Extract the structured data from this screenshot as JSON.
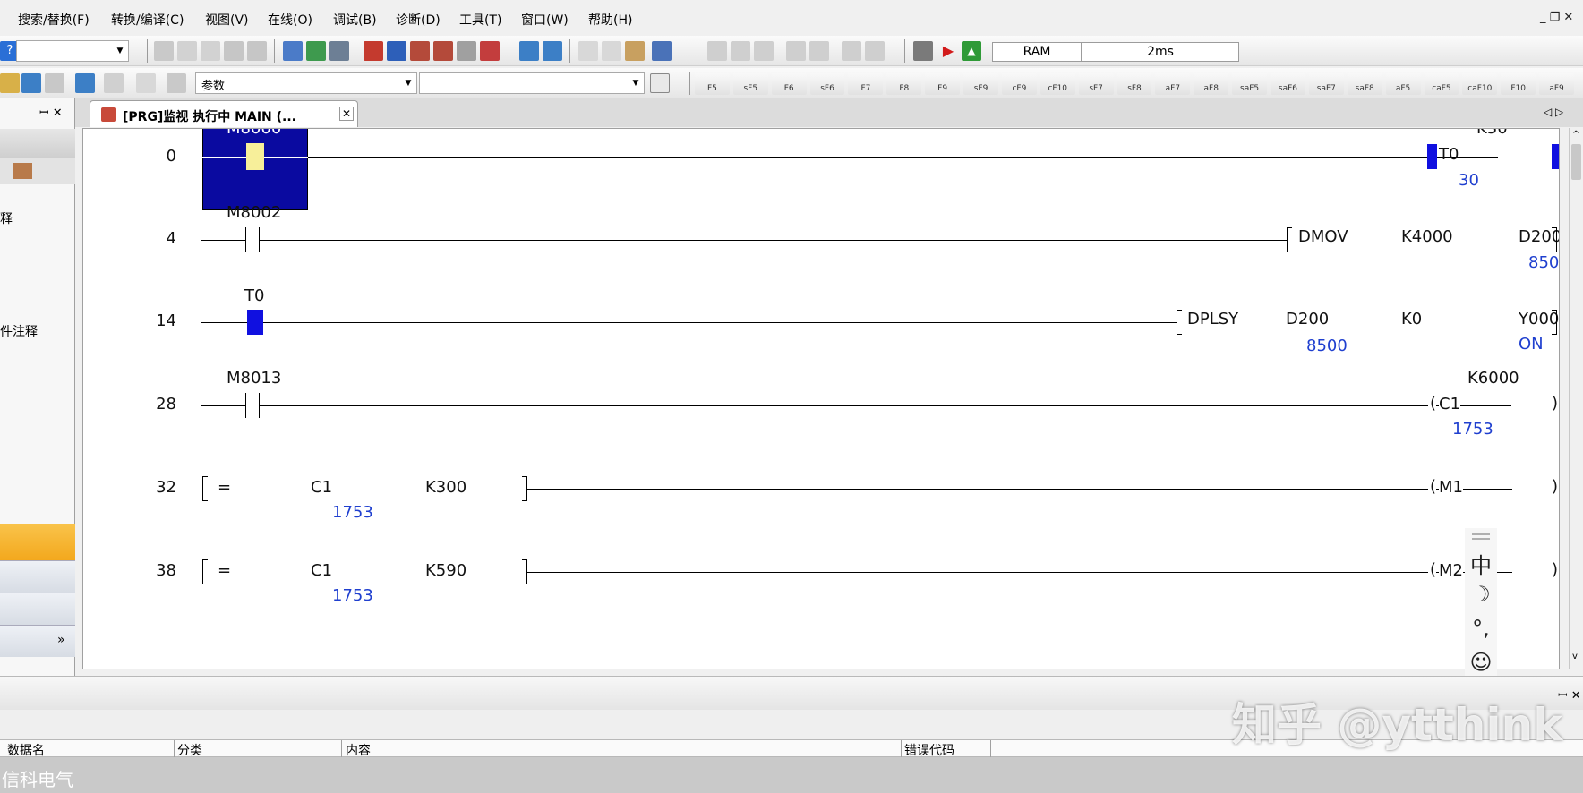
{
  "menu": {
    "items": [
      "搜索/替换(F)",
      "转换/编译(C)",
      "视图(V)",
      "在线(O)",
      "调试(B)",
      "诊断(D)",
      "工具(T)",
      "窗口(W)",
      "帮助(H)"
    ],
    "window_controls": "_ ❐ ✕"
  },
  "toolbar2": {
    "help_icon": "?",
    "status_ram": "RAM",
    "status_scan": "2ms"
  },
  "toolbar3": {
    "param_label": "参数",
    "fkeys": [
      "F5",
      "sF5",
      "F6",
      "sF6",
      "F7",
      "F8",
      "F9",
      "sF9",
      "cF9",
      "cF10",
      "sF7",
      "sF8",
      "aF7",
      "aF8",
      "saF5",
      "saF6",
      "saF7",
      "saF8",
      "aF5",
      "caF5",
      "caF10",
      "F10",
      "aF9"
    ]
  },
  "left_panel": {
    "pin_close": "ꟷ ✕",
    "texts": [
      "释",
      "件注释"
    ]
  },
  "tab": {
    "label": "[PRG]监视 执行中 MAIN (...",
    "close": "✕",
    "nav": "◁ ▷"
  },
  "ladder": {
    "rungs": [
      {
        "no": "0",
        "contact": "M8000",
        "coil": "T0",
        "coil_const": "K30",
        "coil_val": "30"
      },
      {
        "no": "4",
        "contact": "M8002",
        "instr": "DMOV",
        "op1": "K4000",
        "op2": "D200",
        "op2_val": "8500"
      },
      {
        "no": "14",
        "contact": "T0",
        "instr": "DPLSY",
        "op1": "D200",
        "op1_val": "8500",
        "op2": "K0",
        "op3": "Y000",
        "op3_val": "ON"
      },
      {
        "no": "28",
        "contact": "M8013",
        "coil": "C1",
        "coil_const": "K6000",
        "coil_val": "1753"
      },
      {
        "no": "32",
        "cmp": "=",
        "op1": "C1",
        "op1_val": "1753",
        "op2": "K300",
        "coil": "M1"
      },
      {
        "no": "38",
        "cmp": "=",
        "op1": "C1",
        "op1_val": "1753",
        "op2": "K590",
        "coil": "M2"
      }
    ]
  },
  "bottom": {
    "pin_close": "ꟷ ✕",
    "columns": [
      "数据名",
      "分类",
      "内容",
      "错误代码"
    ],
    "status_text": "信科电气"
  },
  "ime": {
    "glyphs": [
      "中",
      "☽",
      "°,",
      "☺",
      "⚙"
    ]
  },
  "watermark": "知乎 @ytthink",
  "colors": {
    "selection": "#0a0aa0",
    "monitor_value": "#1f3fcf",
    "contact_on": "#1010e0",
    "contact_highlight": "#f7ef9a"
  }
}
